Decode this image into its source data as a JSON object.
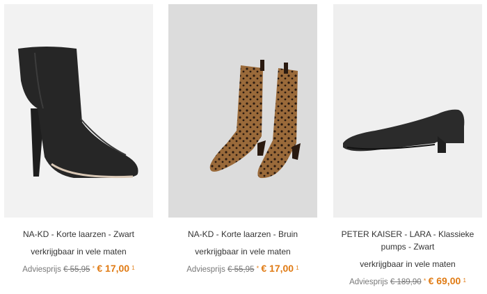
{
  "products": [
    {
      "title": "NA-KD - Korte laarzen - Zwart",
      "availability": "verkrijgbaar in vele maten",
      "advice_label": "Adviesprijs",
      "old_price": "€ 55,95",
      "star": "*",
      "new_price": "€ 17,00",
      "footnote": "1",
      "image_bg": "#f2f2f2"
    },
    {
      "title": "NA-KD - Korte laarzen - Bruin",
      "availability": "verkrijgbaar in vele maten",
      "advice_label": "Adviesprijs",
      "old_price": "€ 55,95",
      "star": "*",
      "new_price": "€ 17,00",
      "footnote": "1",
      "image_bg": "#dcdcdc"
    },
    {
      "title": "PETER KAISER - LARA - Klassieke pumps - Zwart",
      "availability": "verkrijgbaar in vele maten",
      "advice_label": "Adviesprijs",
      "old_price": "€ 189,90",
      "star": "*",
      "new_price": "€ 69,00",
      "footnote": "1",
      "image_bg": "#efefef"
    }
  ],
  "colors": {
    "accent": "#e07b14",
    "text": "#333333",
    "muted": "#777777"
  },
  "icons": [
    "black-ankle-boot-image",
    "leopard-ankle-boots-image",
    "black-suede-pump-image"
  ]
}
